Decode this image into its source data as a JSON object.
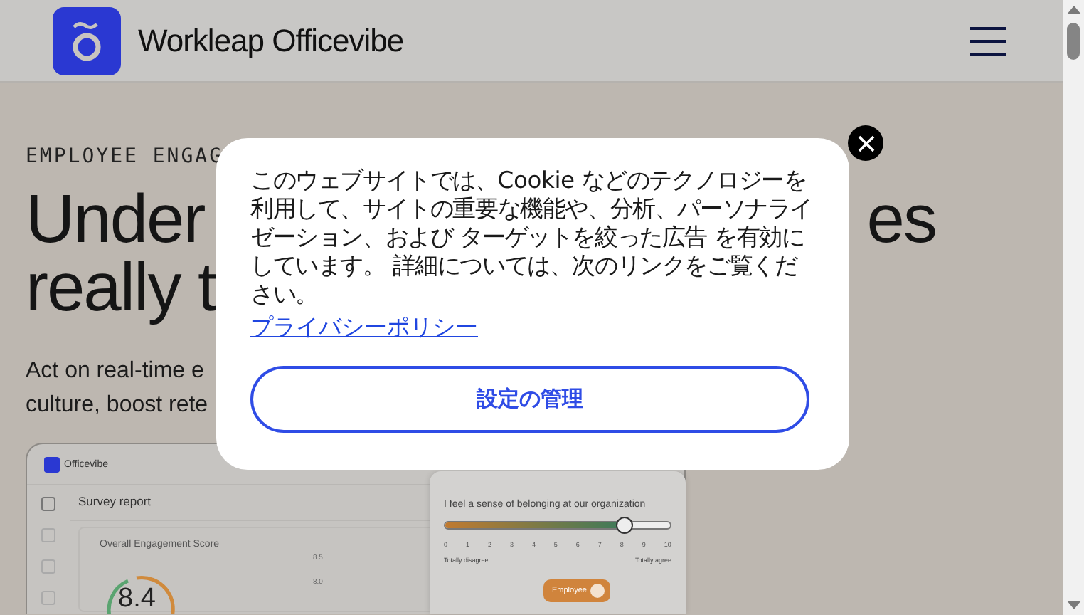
{
  "header": {
    "brand": "Workleap Officevibe"
  },
  "hero": {
    "eyebrow": "EMPLOYEE ENGAG",
    "heading": [
      {
        "left": "Under",
        "right": "es"
      },
      {
        "left": "really t"
      }
    ],
    "intro_lines": [
      "Act on real-time e",
      "culture, boost rete"
    ]
  },
  "dashboard": {
    "brand": "Officevibe",
    "title": "Survey report",
    "score_card": {
      "title": "Overall Engagement Score",
      "score": "8.4",
      "axis": [
        "8.5",
        "8.0"
      ]
    },
    "survey": {
      "question": "I feel a sense of belonging at our organization",
      "level": 0.8,
      "ticks": [
        "0",
        "1",
        "2",
        "3",
        "4",
        "5",
        "6",
        "7",
        "8",
        "9",
        "10"
      ],
      "low_label": "Totally disagree",
      "high_label": "Totally agree",
      "badge": "Employee"
    }
  },
  "cookie_dialog": {
    "message": "このウェブサイトでは、Cookie などのテクノロジーを利用して、サイトの重要な機能や、分析、パーソナライゼーション、および ターゲットを絞った広告 を有効にしています。 詳細については、次のリンクをご覧ください。",
    "link": "プライバシーポリシー",
    "button": "設定の管理"
  }
}
